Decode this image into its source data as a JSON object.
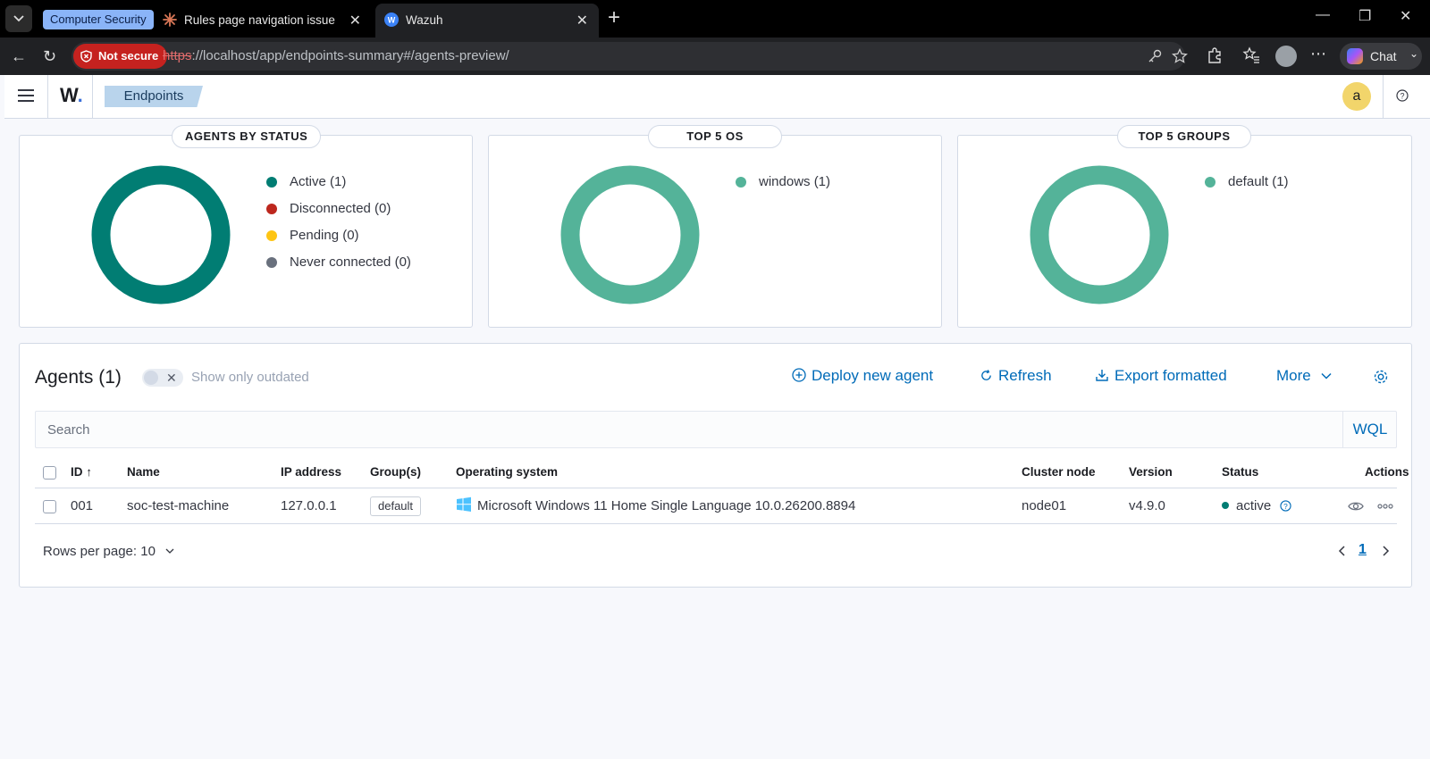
{
  "browser": {
    "tab_group_label": "Computer Security",
    "tabs": [
      {
        "title": "Rules page navigation issue - Claude"
      },
      {
        "title": "Wazuh"
      }
    ],
    "security_label": "Not secure",
    "url_scheme": "https",
    "url_rest": "://localhost/app/endpoints-summary#/agents-preview/",
    "chat_label": "Chat"
  },
  "header": {
    "logo": "W",
    "breadcrumb": "Endpoints",
    "user_initial": "a"
  },
  "colors": {
    "active": "#017d73",
    "disconnected": "#bd271e",
    "pending": "#fec514",
    "never_connected": "#69707d",
    "series_teal": "#54b399",
    "link": "#006bb8"
  },
  "status_card": {
    "title": "AGENTS BY STATUS",
    "legend": [
      {
        "label": "Active (1)",
        "color": "#017d73"
      },
      {
        "label": "Disconnected (0)",
        "color": "#bd271e"
      },
      {
        "label": "Pending (0)",
        "color": "#fec514"
      },
      {
        "label": "Never connected (0)",
        "color": "#69707d"
      }
    ]
  },
  "os_card": {
    "title": "TOP 5 OS",
    "legend": [
      {
        "label": "windows (1)",
        "color": "#54b399"
      }
    ]
  },
  "groups_card": {
    "title": "TOP 5 GROUPS",
    "legend": [
      {
        "label": "default (1)",
        "color": "#54b399"
      }
    ]
  },
  "agents": {
    "title": "Agents (1)",
    "toggle_label": "Show only outdated",
    "actions": {
      "deploy": "Deploy new agent",
      "refresh": "Refresh",
      "export": "Export formatted",
      "more": "More"
    },
    "search_placeholder": "Search",
    "wql": "WQL",
    "columns": {
      "id": "ID",
      "name": "Name",
      "ip": "IP address",
      "groups": "Group(s)",
      "os": "Operating system",
      "cluster": "Cluster node",
      "version": "Version",
      "status": "Status",
      "actions": "Actions"
    },
    "rows": [
      {
        "id": "001",
        "name": "soc-test-machine",
        "ip": "127.0.0.1",
        "group": "default",
        "os": "Microsoft Windows 11 Home Single Language 10.0.26200.8894",
        "cluster": "node01",
        "version": "v4.9.0",
        "status": "active"
      }
    ],
    "rows_per_page": "Rows per page: 10",
    "page": "1"
  }
}
